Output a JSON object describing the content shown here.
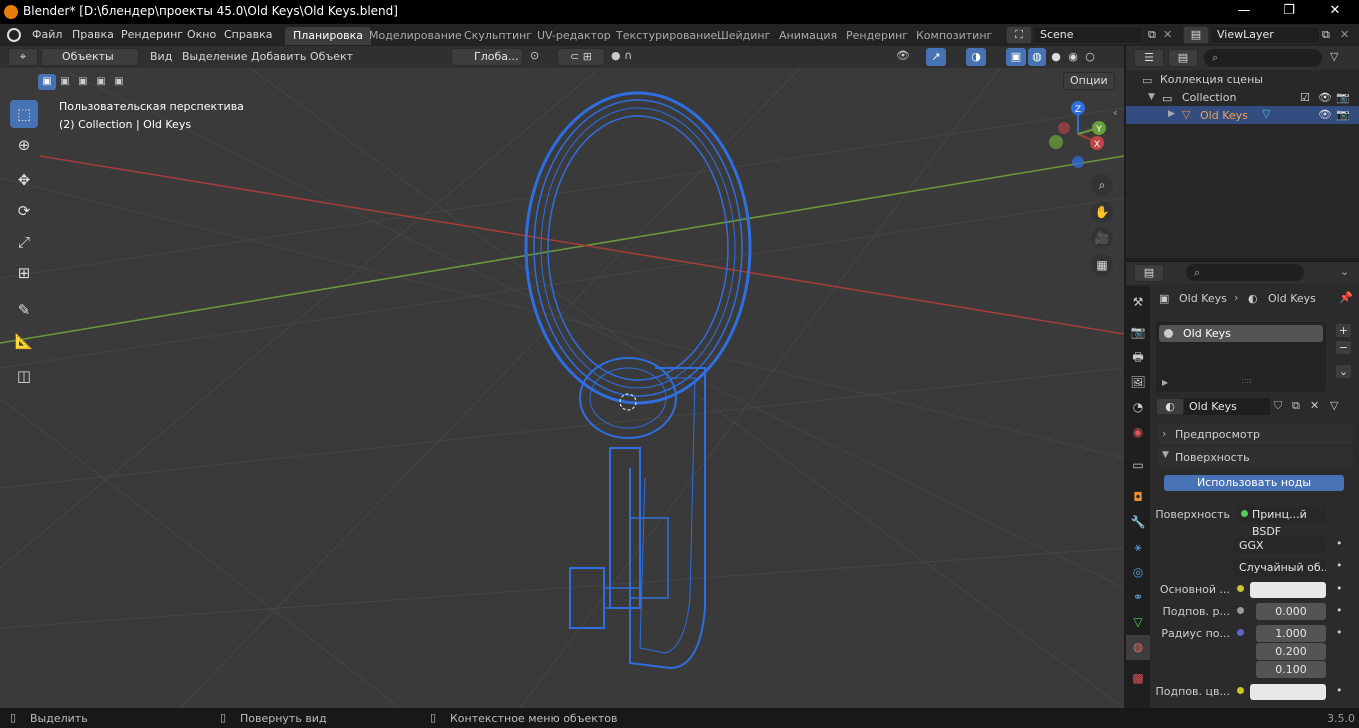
{
  "titlebar": {
    "title": "Blender* [D:\\блендер\\проекты 45.0\\Old Keys\\Old Keys.blend]",
    "minimize": "—",
    "maximize": "❐",
    "close": "✕"
  },
  "menu": {
    "items": [
      "Файл",
      "Правка",
      "Рендеринг",
      "Окно",
      "Справка"
    ]
  },
  "workspaces": {
    "tabs": [
      "Планировка",
      "Моделирование",
      "Скульптинг",
      "UV-редактор",
      "Текстурирование",
      "Шейдинг",
      "Анимация",
      "Рендеринг",
      "Композитинг"
    ],
    "active": "Планировка"
  },
  "scene": {
    "label": "Scene",
    "viewlayer": "ViewLayer"
  },
  "viewport_header": {
    "mode": "Объекты",
    "menus": [
      "Вид",
      "Выделение",
      "Добавить",
      "Объект"
    ],
    "orientation": "Глоба...",
    "options": "Опции"
  },
  "viewport": {
    "info_line1": "Пользовательская перспектива",
    "info_line2": "(2) Collection | Old Keys",
    "axis_x": "X",
    "axis_y": "Y",
    "axis_z": "Z"
  },
  "outliner": {
    "root": "Коллекция сцены",
    "collection": "Collection",
    "object": "Old Keys"
  },
  "properties": {
    "breadcrumb_object": "Old Keys",
    "breadcrumb_material": "Old Keys",
    "slot_name": "Old Keys",
    "material_name": "Old Keys",
    "panel_preview": "Предпросмотр",
    "panel_surface": "Поверхность",
    "use_nodes": "Использовать ноды",
    "surface_label": "Поверхность",
    "surface_value": "Принц...й BSDF",
    "distribution": "GGX",
    "subsurface_method": "Случайный об...",
    "base_color_label": "Основной ...",
    "subsurface_label": "Подпов. р...",
    "subsurface_value": "0.000",
    "radius_label": "Радиус по...",
    "radius_values": [
      "1.000",
      "0.200",
      "0.100"
    ],
    "subsurface_color_label": "Подпов. цв..."
  },
  "statusbar": {
    "select": "Выделить",
    "rotate": "Повернуть вид",
    "context": "Контекстное меню объектов",
    "version": "3.5.0"
  },
  "colors": {
    "wire": "#2f6ee0",
    "accent": "#4772b3",
    "x_axis": "#a83a3a",
    "y_axis": "#6a9a3a"
  }
}
